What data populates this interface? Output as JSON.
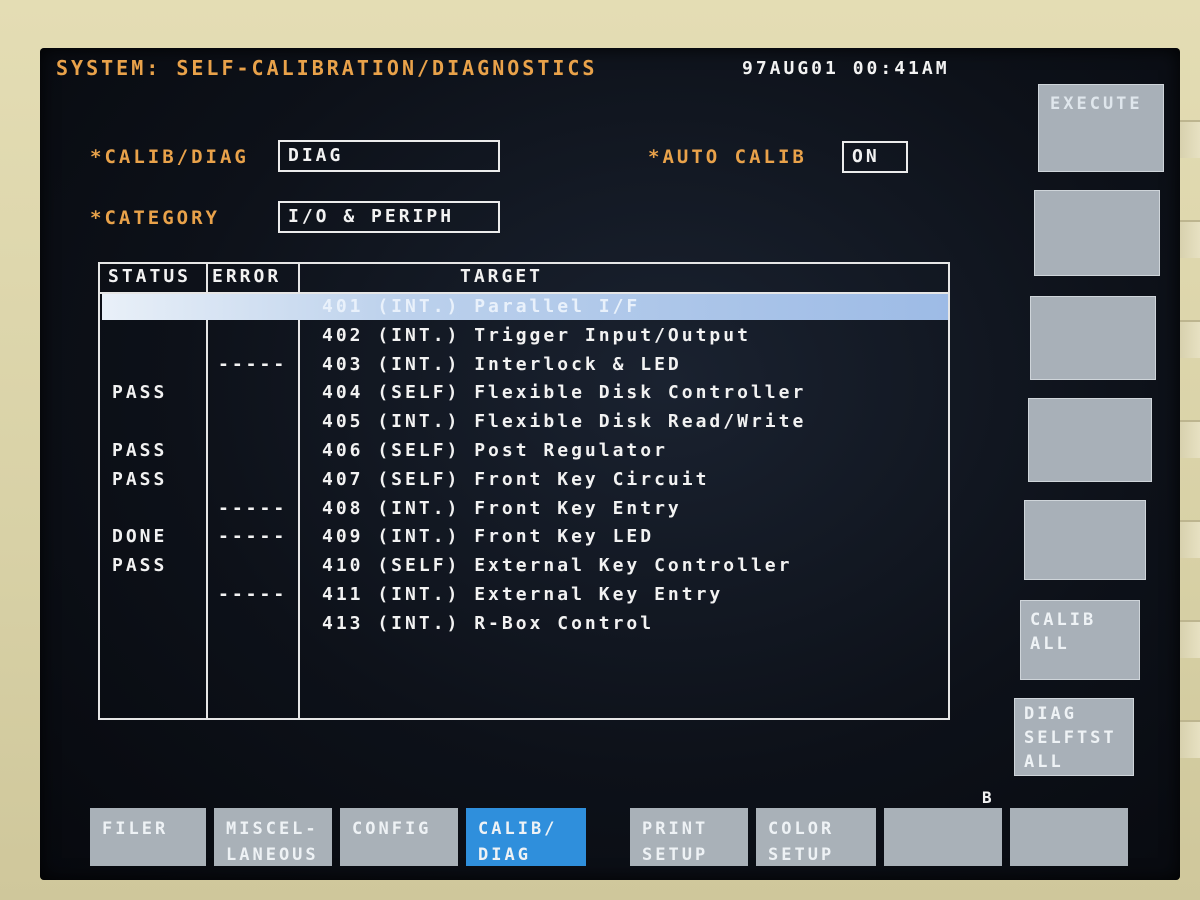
{
  "header": {
    "title": "SYSTEM: SELF-CALIBRATION/DIAGNOSTICS",
    "datetime": "97AUG01 00:41AM"
  },
  "fields": {
    "calib_diag": {
      "label": "*CALIB/DIAG",
      "value": "DIAG"
    },
    "category": {
      "label": "*CATEGORY",
      "value": "I/O & PERIPH"
    },
    "auto_calib": {
      "label": "*AUTO CALIB",
      "value": "ON"
    }
  },
  "table": {
    "columns": [
      "STATUS",
      "ERROR",
      "TARGET"
    ],
    "rows": [
      {
        "status": "",
        "error": "",
        "target": "401 (INT.) Parallel I/F",
        "selected": true
      },
      {
        "status": "",
        "error": "",
        "target": "402 (INT.) Trigger Input/Output"
      },
      {
        "status": "",
        "error": "-----",
        "target": "403 (INT.) Interlock & LED"
      },
      {
        "status": "PASS",
        "error": "",
        "target": "404 (SELF) Flexible Disk Controller"
      },
      {
        "status": "",
        "error": "",
        "target": "405 (INT.) Flexible Disk Read/Write"
      },
      {
        "status": "PASS",
        "error": "",
        "target": "406 (SELF) Post Regulator"
      },
      {
        "status": "PASS",
        "error": "",
        "target": "407 (SELF) Front Key Circuit"
      },
      {
        "status": "",
        "error": "-----",
        "target": "408 (INT.) Front Key Entry"
      },
      {
        "status": "DONE",
        "error": "-----",
        "target": "409 (INT.) Front Key LED"
      },
      {
        "status": "PASS",
        "error": "",
        "target": "410 (SELF) External Key Controller"
      },
      {
        "status": "",
        "error": "-----",
        "target": "411 (INT.) External Key Entry"
      },
      {
        "status": "",
        "error": "",
        "target": "413 (INT.) R-Box Control"
      }
    ]
  },
  "softkeys": {
    "execute": "EXECUTE",
    "calib_all": "CALIB\nALL",
    "diag_selftst_all": "DIAG\nSELFTST\nALL"
  },
  "menu": {
    "filer": "FILER",
    "miscellaneous": "MISCEL-\nLANEOUS",
    "config": "CONFIG",
    "calib_diag": "CALIB/\nDIAG",
    "print_setup": "PRINT\nSETUP",
    "color_setup": "COLOR\nSETUP"
  },
  "indicator": "B",
  "colors": {
    "label_orange": "#e9a24a",
    "active_menu_blue": "#2f8fdc",
    "softkey_gray": "#a9b1b8"
  }
}
